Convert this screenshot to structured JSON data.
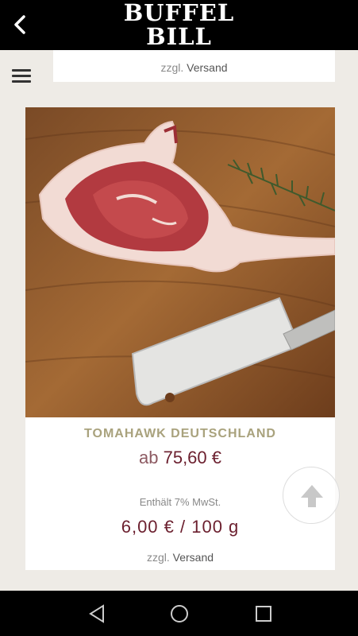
{
  "header": {
    "logo_line1": "BUFFEL",
    "logo_line2": "BILL",
    "back_icon": "chevron-left-icon"
  },
  "menu": {
    "icon": "hamburger-menu-icon"
  },
  "previous_card": {
    "shipping_prefix": "zzgl.",
    "shipping_link": "Versand"
  },
  "product": {
    "title": "TOMAHAWK DEUTSCHLAND",
    "price_prefix": "ab",
    "price": "75,60 €",
    "tax_note": "Enthält 7% MwSt.",
    "unit_price": "6,00 € / 100 g",
    "shipping_prefix": "zzgl.",
    "shipping_link": "Versand",
    "image_alt": "Tomahawk steak on wooden board with cleaver and rosemary"
  },
  "scroll_top": {
    "icon": "arrow-up-icon"
  },
  "android_nav": {
    "back": "nav-back-icon",
    "home": "nav-home-icon",
    "recents": "nav-recents-icon"
  },
  "colors": {
    "accent_title": "#a9a27d",
    "price": "#6b1f2e",
    "background": "#eeebe6"
  }
}
